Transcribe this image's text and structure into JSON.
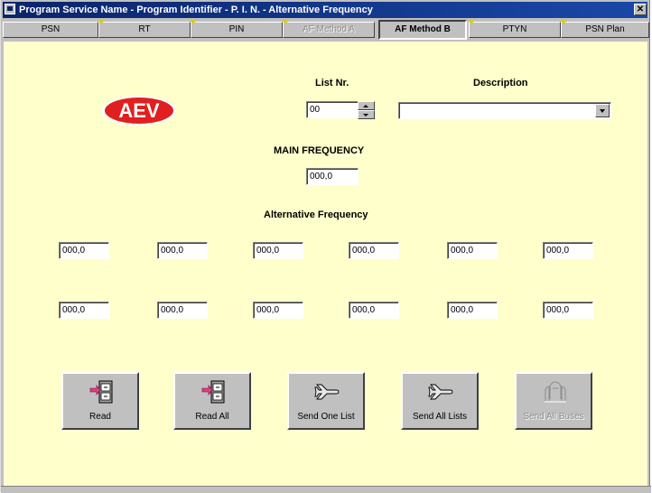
{
  "window": {
    "title": "Program Service Name - Program Identifier - P. I. N. - Alternative Frequency",
    "close_glyph": "✕"
  },
  "tabs": [
    {
      "label": "PSN",
      "state": "normal"
    },
    {
      "label": "RT",
      "state": "normal"
    },
    {
      "label": "PIN",
      "state": "normal"
    },
    {
      "label": "AF Method A",
      "state": "disabled"
    },
    {
      "label": "AF Method B",
      "state": "active"
    },
    {
      "label": "PTYN",
      "state": "normal"
    },
    {
      "label": "PSN Plan",
      "state": "normal"
    }
  ],
  "logo": {
    "text": "AEV",
    "fill_color": "#e02020",
    "text_color": "#ffffff"
  },
  "list_nr": {
    "label": "List Nr.",
    "value": "00"
  },
  "description": {
    "label": "Description",
    "value": ""
  },
  "main_frequency": {
    "label": "MAIN FREQUENCY",
    "value": "000,0"
  },
  "alternative_frequency": {
    "label": "Alternative Frequency",
    "row1": [
      "000,0",
      "000,0",
      "000,0",
      "000,0",
      "000,0",
      "000,0"
    ],
    "row2": [
      "000,0",
      "000,0",
      "000,0",
      "000,0",
      "000,0",
      "000,0"
    ]
  },
  "buttons": [
    {
      "label": "Read",
      "icon": "file-cabinet-arrow-icon",
      "enabled": true
    },
    {
      "label": "Read All",
      "icon": "file-cabinet-arrow-icon",
      "enabled": true
    },
    {
      "label": "Send One List",
      "icon": "airplane-icon",
      "enabled": true
    },
    {
      "label": "Send All Lists",
      "icon": "airplane-icon",
      "enabled": true
    },
    {
      "label": "Send All Buses",
      "icon": "buses-icon",
      "enabled": false
    }
  ]
}
